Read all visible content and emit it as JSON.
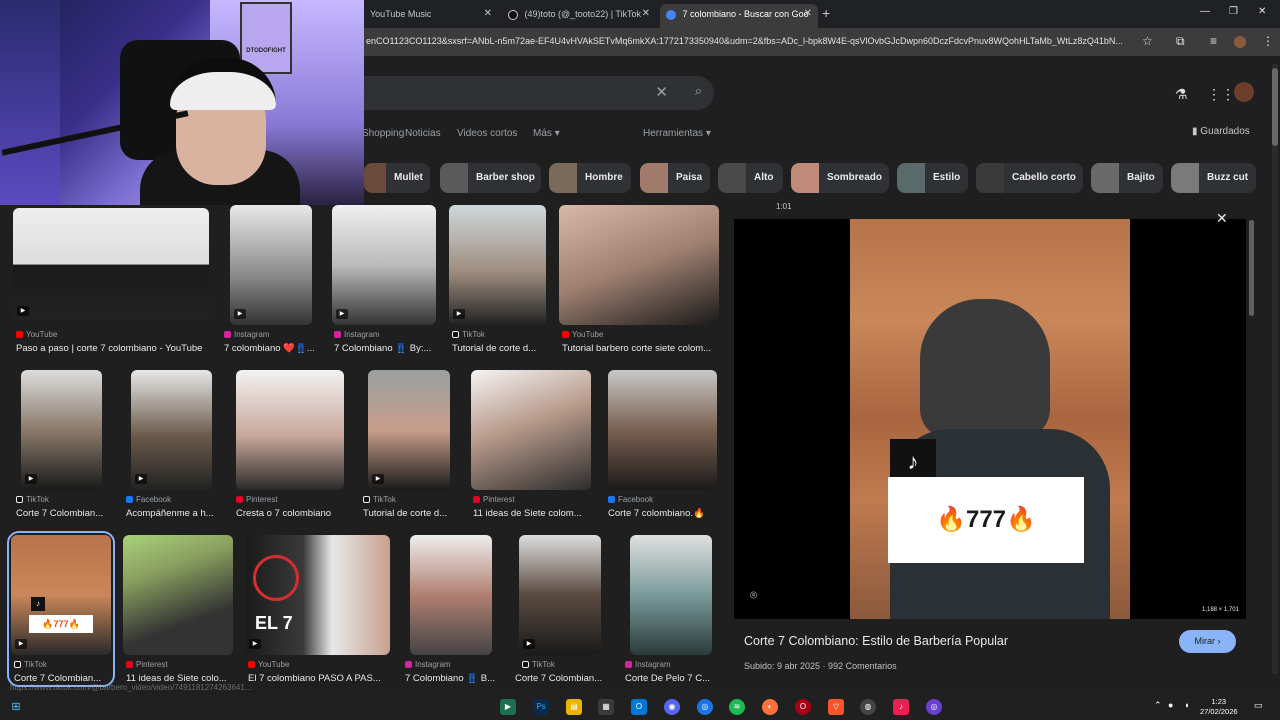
{
  "browser": {
    "tabs": [
      {
        "label": "YouTube Music",
        "active": false
      },
      {
        "label": "(49)toto (@_tooto22) | TikTok",
        "active": false
      },
      {
        "label": "7 colombiano - Buscar con Goo",
        "active": true
      }
    ],
    "new_tab": "+",
    "url": "enCO1123CO1123&sxsrf=ANbL-n5m72ae-EF4U4vHVAkSETvMq6mkXA:1772173350940&udm=2&fbs=ADc_l-bpk8W4E-qsVlOvbGJcDwpn60DczFdcvPnuv8WQohHLTaMb_WtLz8zQ41bN..."
  },
  "search": {
    "tabs": [
      "Shopping",
      "Noticias",
      "Videos cortos",
      "Más"
    ],
    "tools": "Herramientas",
    "saved": "Guardados",
    "chips": [
      "Mullet",
      "Barber shop",
      "Hombre",
      "Paisa",
      "Alto",
      "Sombreado",
      "Estilo",
      "Cabello corto",
      "Bajito",
      "Buzz cut"
    ]
  },
  "webcam": {
    "poster_text": "DTODOFIGHT"
  },
  "results": [
    {
      "source": "YouTube",
      "caption": "Paso a paso | corte 7 colombiano - YouTube"
    },
    {
      "source": "Instagram",
      "caption": "7 colombiano ❤️👖..."
    },
    {
      "source": "Instagram",
      "caption": "7 Colombiano 👖 By:..."
    },
    {
      "source": "TikTok",
      "caption": "Tutorial de corte d..."
    },
    {
      "source": "YouTube",
      "caption": "Tutorial barbero corte siete colom..."
    },
    {
      "source": "TikTok",
      "caption": "Corte 7 Colombian..."
    },
    {
      "source": "Facebook",
      "caption": "Acompáñenme a h..."
    },
    {
      "source": "Pinterest",
      "caption": "Cresta o 7 colombiano"
    },
    {
      "source": "TikTok",
      "caption": "Tutorial de corte d..."
    },
    {
      "source": "Pinterest",
      "caption": "11 ideas de Siete colom..."
    },
    {
      "source": "Facebook",
      "caption": "Corte 7 colombiano.🔥"
    },
    {
      "source": "TikTok",
      "caption": "Corte 7 Colombian..."
    },
    {
      "source": "Pinterest",
      "caption": "11 ideas de Siete colo..."
    },
    {
      "source": "YouTube",
      "caption": "El 7 colombiano PASO A PAS..."
    },
    {
      "source": "Instagram",
      "caption": "7 Colombiano 👖 B..."
    },
    {
      "source": "TikTok",
      "caption": "Corte 7 Colombian..."
    },
    {
      "source": "Instagram",
      "caption": "Corte De Pelo 7 C..."
    }
  ],
  "overlay_texts": {
    "fire_777": "🔥777🔥",
    "el7": "EL 7",
    "thumb_777": "🔥777🔥"
  },
  "preview": {
    "time": "1:01",
    "title": "Corte 7 Colombiano: Estilo de Barbería Popular",
    "meta": "Subido: 9 abr 2025 · 992 Comentarios",
    "button": "Mirar ›",
    "dims": "1,188 × 1,701",
    "overlay": "🔥777🔥"
  },
  "taskbar": {
    "time": "1:23",
    "date": "27/02/2026"
  },
  "status_url": "https://www.tiktok.com/@barbero_video/video/7491181274263641..."
}
